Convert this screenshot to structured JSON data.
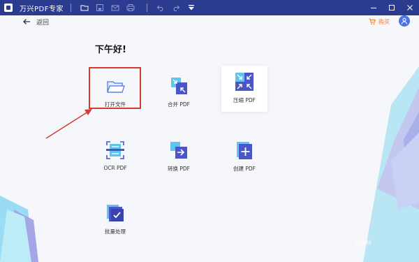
{
  "app": {
    "title": "万兴PDF专家"
  },
  "nav": {
    "back_label": "返回",
    "buy_label": "购买"
  },
  "greeting": "下午好!",
  "tiles": [
    {
      "label": "打开文件"
    },
    {
      "label": "合并 PDF"
    },
    {
      "label": "压缩 PDF"
    },
    {
      "label": "OCR PDF"
    },
    {
      "label": "转换 PDF"
    },
    {
      "label": "创建 PDF"
    },
    {
      "label": "批量处理"
    }
  ],
  "colors": {
    "titlebar": "#2b3b8f",
    "accent": "#4d72e6",
    "buy": "#f07a23",
    "highlight": "#d63a2f"
  },
  "watermark": "系统粉"
}
